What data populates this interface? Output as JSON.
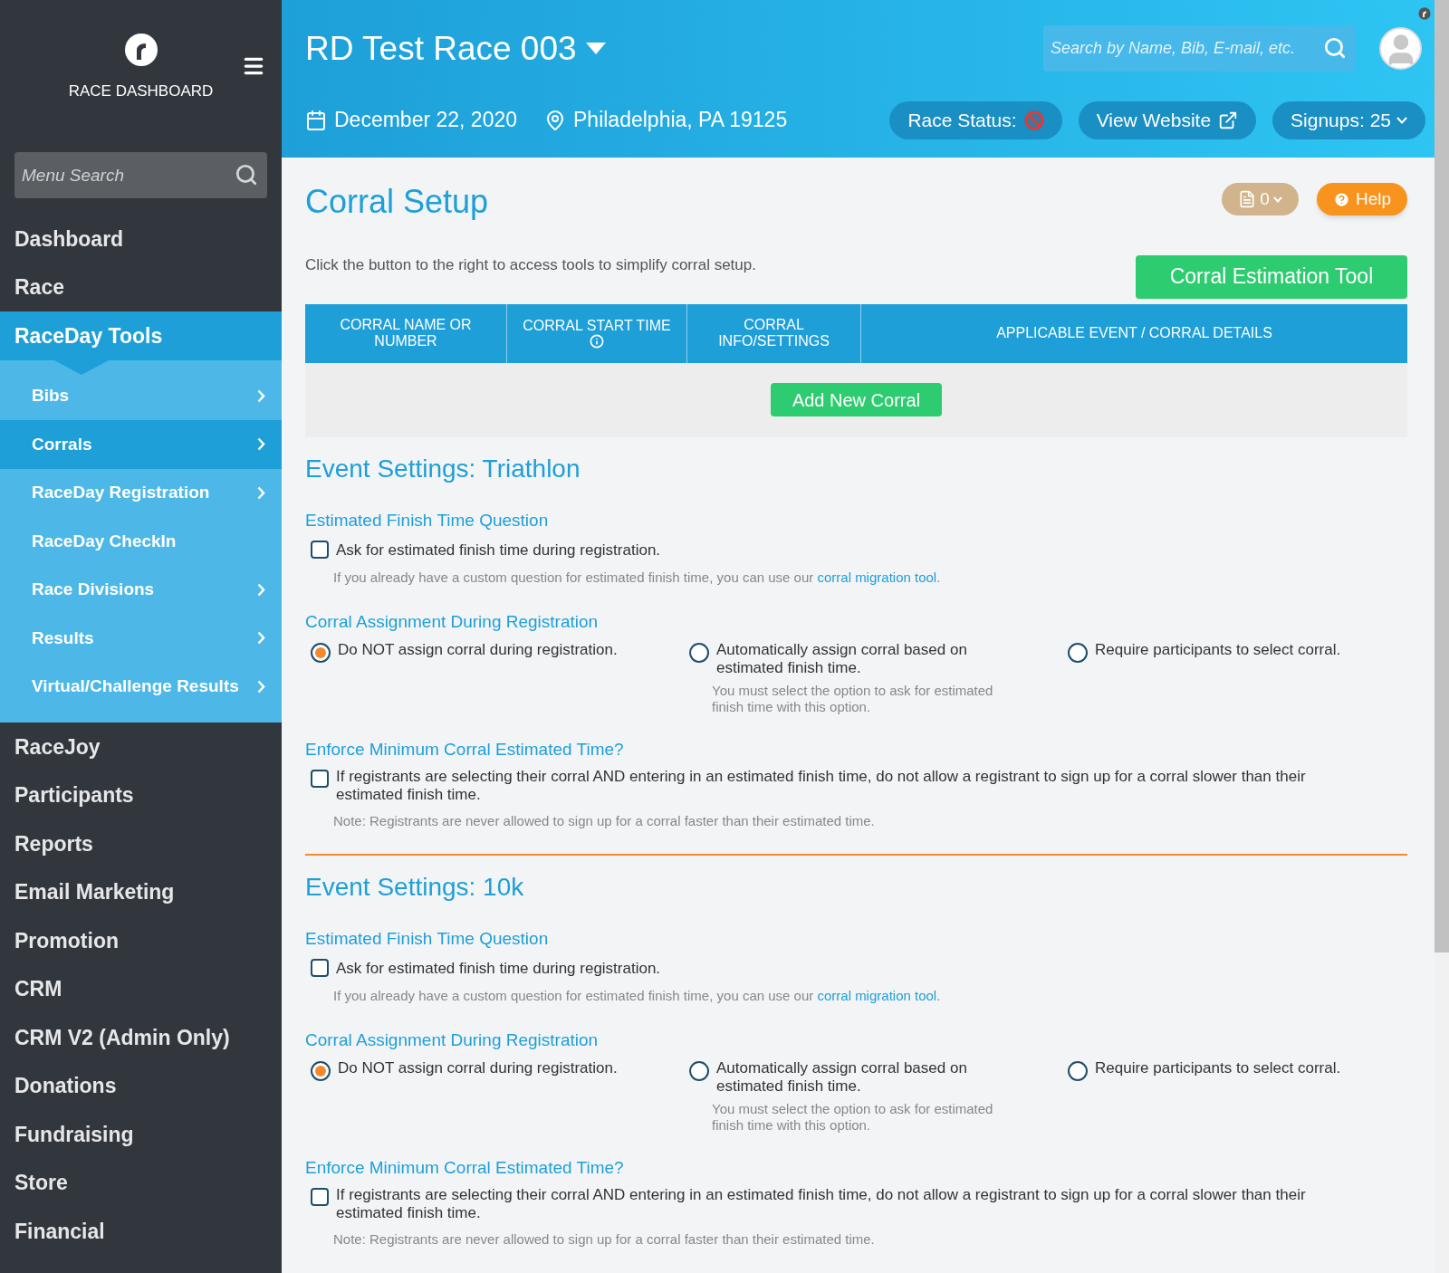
{
  "sidebar": {
    "brand": "RACE DASHBOARD",
    "search_placeholder": "Menu Search",
    "items": [
      {
        "label": "Dashboard",
        "selected": false
      },
      {
        "label": "Race",
        "selected": false
      },
      {
        "label": "RaceDay Tools",
        "selected": true,
        "children": [
          {
            "label": "Bibs",
            "selected": false,
            "has_submenu": true
          },
          {
            "label": "Corrals",
            "selected": true,
            "has_submenu": true
          },
          {
            "label": "RaceDay Registration",
            "selected": false,
            "has_submenu": true
          },
          {
            "label": "RaceDay CheckIn",
            "selected": false,
            "has_submenu": false
          },
          {
            "label": "Race Divisions",
            "selected": false,
            "has_submenu": true
          },
          {
            "label": "Results",
            "selected": false,
            "has_submenu": true
          },
          {
            "label": "Virtual/Challenge Results",
            "selected": false,
            "has_submenu": true
          }
        ]
      },
      {
        "label": "RaceJoy",
        "selected": false
      },
      {
        "label": "Participants",
        "selected": false
      },
      {
        "label": "Reports",
        "selected": false
      },
      {
        "label": "Email Marketing",
        "selected": false
      },
      {
        "label": "Promotion",
        "selected": false
      },
      {
        "label": "CRM",
        "selected": false
      },
      {
        "label": "CRM V2 (Admin Only)",
        "selected": false
      },
      {
        "label": "Donations",
        "selected": false
      },
      {
        "label": "Fundraising",
        "selected": false
      },
      {
        "label": "Store",
        "selected": false
      },
      {
        "label": "Financial",
        "selected": false
      }
    ]
  },
  "header": {
    "race_title": "RD Test Race 003",
    "date": "December 22, 2020",
    "location": "Philadelphia, PA 19125",
    "search_placeholder": "Search by Name, Bib, E-mail, etc.",
    "race_status": "Race Status:",
    "view_website": "View Website",
    "signups": "Signups: 25"
  },
  "page": {
    "title": "Corral Setup",
    "notes_count": "0",
    "help": "Help",
    "intro": "Click the button to the right to access tools to simplify corral setup.",
    "tool_button": "Corral Estimation Tool",
    "table": {
      "columns": [
        {
          "label": "CORRAL NAME OR NUMBER",
          "info": false
        },
        {
          "label": "CORRAL START TIME",
          "info": true
        },
        {
          "label": "CORRAL INFO/SETTINGS",
          "info": false
        },
        {
          "label": "APPLICABLE EVENT / CORRAL DETAILS",
          "info": false
        }
      ],
      "add_button": "Add New Corral"
    },
    "events": [
      {
        "title": "Event Settings: Triathlon",
        "finish_question": {
          "heading": "Estimated Finish Time Question",
          "label": "Ask for estimated finish time during registration.",
          "checked": false,
          "note": "If you already have a custom question for estimated finish time, you can use our",
          "link": "corral migration tool",
          "note_end": "."
        },
        "assignment": {
          "heading": "Corral Assignment During Registration",
          "options": [
            {
              "label": "Do NOT assign corral during registration.",
              "selected": true
            },
            {
              "label": "Automatically assign corral based on estimated finish time.",
              "selected": false,
              "note": "You must select the option to ask for estimated finish time with this option."
            },
            {
              "label": "Require participants to select corral.",
              "selected": false
            }
          ]
        },
        "enforce": {
          "heading": "Enforce Minimum Corral Estimated Time?",
          "label": "If registrants are selecting their corral AND entering in an estimated finish time, do not allow a registrant to sign up for a corral slower than their estimated finish time.",
          "checked": false,
          "note": "Note: Registrants are never allowed to sign up for a corral faster than their estimated time."
        }
      },
      {
        "title": "Event Settings: 10k",
        "finish_question": {
          "heading": "Estimated Finish Time Question",
          "label": "Ask for estimated finish time during registration.",
          "checked": false,
          "note": "If you already have a custom question for estimated finish time, you can use our",
          "link": "corral migration tool",
          "note_end": "."
        },
        "assignment": {
          "heading": "Corral Assignment During Registration",
          "options": [
            {
              "label": "Do NOT assign corral during registration.",
              "selected": true
            },
            {
              "label": "Automatically assign corral based on estimated finish time.",
              "selected": false,
              "note": "You must select the option to ask for estimated finish time with this option."
            },
            {
              "label": "Require participants to select corral.",
              "selected": false
            }
          ]
        },
        "enforce": {
          "heading": "Enforce Minimum Corral Estimated Time?",
          "label": "If registrants are selecting their corral AND entering in an estimated finish time, do not allow a registrant to sign up for a corral slower than their estimated finish time.",
          "checked": false,
          "note": "Note: Registrants are never allowed to sign up for a corral faster than their estimated time."
        }
      }
    ]
  }
}
